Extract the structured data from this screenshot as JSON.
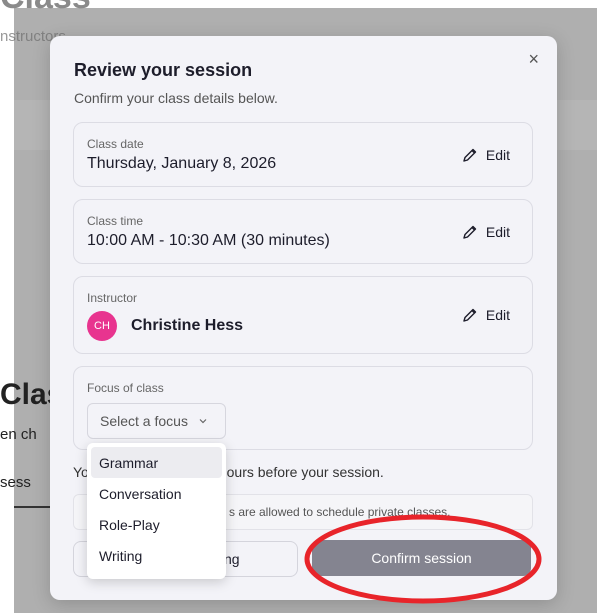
{
  "background": {
    "title_fragment": "Class",
    "subtitle_fragment": "nstructors",
    "heading_fragment": "Clas",
    "text_fragment": "en ch",
    "sess_fragment": "sess"
  },
  "modal": {
    "title": "Review your session",
    "subtitle": "Confirm your class details below.",
    "close_symbol": "×",
    "class_date": {
      "label": "Class date",
      "value": "Thursday, January 8, 2026",
      "edit": "Edit"
    },
    "class_time": {
      "label": "Class time",
      "value": "10:00 AM - 10:30 AM (30 minutes)",
      "edit": "Edit"
    },
    "instructor": {
      "label": "Instructor",
      "initials": "CH",
      "name": "Christine Hess",
      "edit": "Edit"
    },
    "focus": {
      "label": "Focus of class",
      "placeholder": "Select a focus"
    },
    "notice_start": "Yo",
    "notice_end": "hours before your session.",
    "info_text": "s are allowed to schedule private classes.",
    "secondary_button": "ng",
    "confirm_button": "Confirm session"
  },
  "dropdown": {
    "options": [
      "Grammar",
      "Conversation",
      "Role-Play",
      "Writing"
    ],
    "highlighted": "Grammar"
  },
  "colors": {
    "avatar": "#e8348f",
    "confirm_button": "#848490",
    "annotation_ring": "#e8242a"
  },
  "icons": {
    "edit": "pencil-icon",
    "close": "close-icon",
    "select": "chevron-down-icon"
  }
}
